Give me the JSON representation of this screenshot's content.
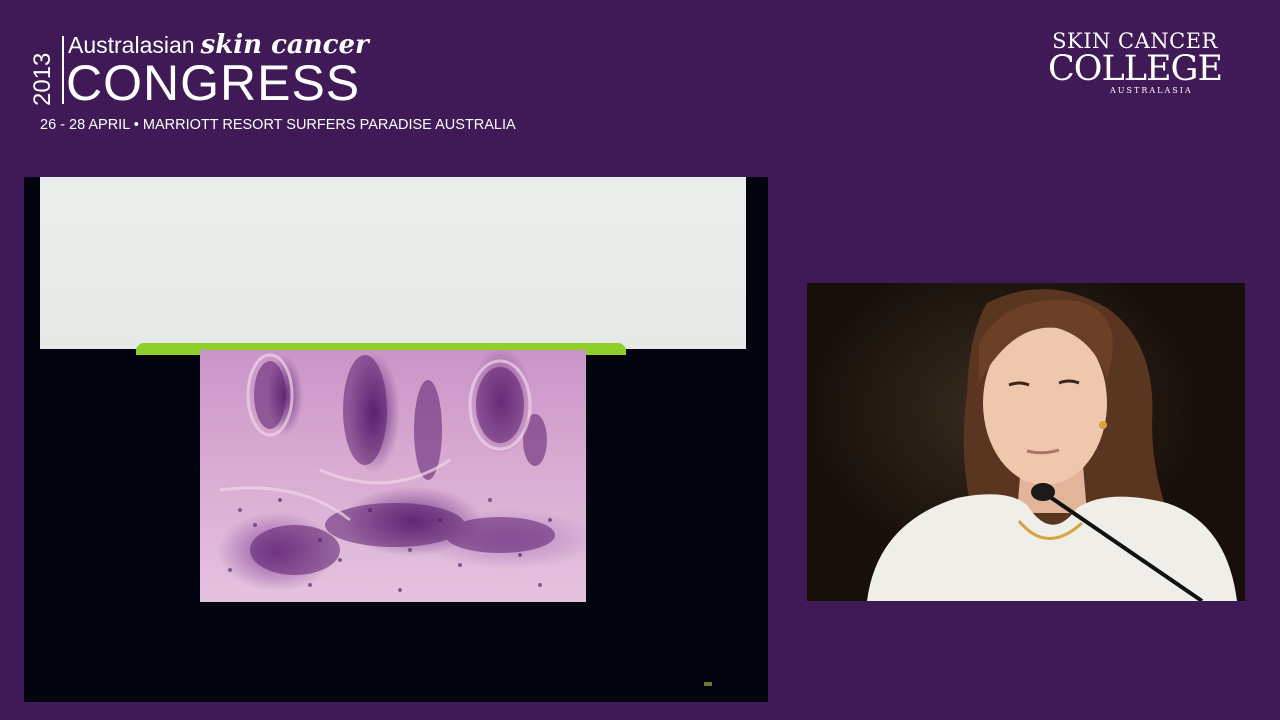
{
  "event": {
    "year": "2013",
    "line1_light": "Australasian",
    "line1_bold": "skin cancer",
    "line2": "CONGRESS",
    "subline": "26 - 28 APRIL • MARRIOTT RESORT SURFERS PARADISE AUSTRALIA"
  },
  "college": {
    "line1": "SKIN CANCER",
    "line2": "COLLEGE",
    "line3": "AUSTRALASIA"
  },
  "colors": {
    "background": "#3f1a57",
    "slide_background": "#02050f",
    "slide_accent": "#8fcf2a"
  },
  "icons": {
    "speaker": "speaker-video-feed",
    "microphone": "microphone-icon"
  }
}
